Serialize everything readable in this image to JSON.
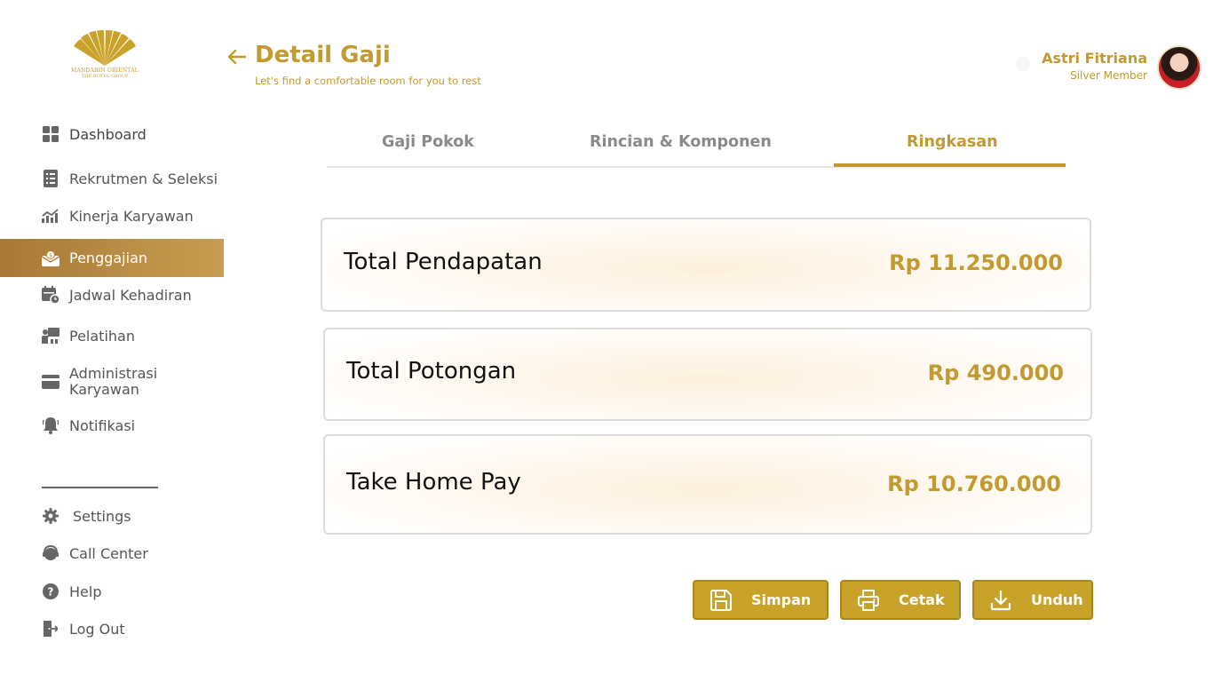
{
  "brand": {
    "line1": "MANDARIN ORIENTAL",
    "line2": "THE HOTEL GROUP"
  },
  "sidebar": {
    "items": [
      {
        "label": "Dashboard",
        "icon": "dashboard-grid-icon"
      },
      {
        "label": "Rekrutmen & Seleksi",
        "icon": "clipboard-list-icon"
      },
      {
        "label": "Kinerja Karyawan",
        "icon": "chart-up-icon"
      },
      {
        "label": "Penggajian",
        "icon": "payroll-envelope-icon"
      },
      {
        "label": "Jadwal Kehadiran",
        "icon": "calendar-clock-icon"
      },
      {
        "label": "Pelatihan",
        "icon": "training-board-icon"
      },
      {
        "label": "Administrasi Karyawan",
        "icon": "card-icon"
      },
      {
        "label": "Notifikasi",
        "icon": "bell-icon"
      }
    ],
    "bottom": [
      {
        "label": "Settings",
        "icon": "gear-icon"
      },
      {
        "label": "Call Center",
        "icon": "headset-icon"
      },
      {
        "label": "Help",
        "icon": "help-icon"
      },
      {
        "label": "Log Out",
        "icon": "logout-icon"
      }
    ],
    "active": "Penggajian"
  },
  "header": {
    "title": "Detail Gaji",
    "subtitle": "Let's find a comfortable room for you to rest"
  },
  "user": {
    "name": "Astri Fitriana",
    "tier": "Silver Member"
  },
  "tabs": [
    {
      "label": "Gaji Pokok"
    },
    {
      "label": "Rincian & Komponen"
    },
    {
      "label": "Ringkasan"
    }
  ],
  "active_tab": "Ringkasan",
  "summary": [
    {
      "label": "Total Pendapatan",
      "value": "Rp 11.250.000"
    },
    {
      "label": "Total Potongan",
      "value": "Rp 490.000"
    },
    {
      "label": "Take Home Pay",
      "value": "Rp 10.760.000"
    }
  ],
  "actions": {
    "save": "Simpan",
    "print": "Cetak",
    "download": "Unduh"
  },
  "colors": {
    "accent": "#c39a2f",
    "button": "#c9a22a",
    "active_nav_start": "#a87934",
    "active_nav_end": "#c69d52"
  }
}
